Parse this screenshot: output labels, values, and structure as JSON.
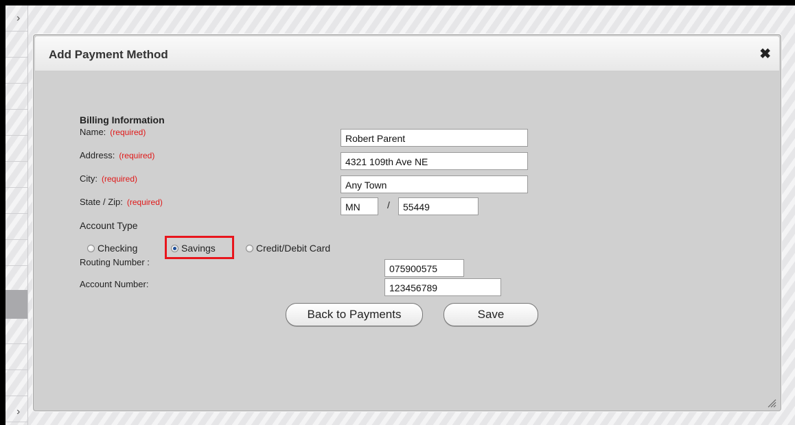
{
  "dialog": {
    "title": "Add Payment Method",
    "close_glyph": "✖"
  },
  "billing": {
    "section_title": "Billing Information",
    "required_text": "(required)",
    "name_label": "Name:",
    "name_value": "Robert Parent",
    "address_label": "Address:",
    "address_value": "4321 109th Ave NE",
    "city_label": "City:",
    "city_value": "Any Town",
    "state_zip_label": "State / Zip:",
    "state_value": "MN",
    "zip_separator": "/",
    "zip_value": "55449"
  },
  "account_type": {
    "label": "Account Type",
    "options": [
      "Checking",
      "Savings",
      "Credit/Debit Card"
    ],
    "selected": "Savings"
  },
  "bank": {
    "routing_label": "Routing Number :",
    "routing_value": "075900575",
    "account_label": "Account Number:",
    "account_value": "123456789"
  },
  "buttons": {
    "back_label": "Back to Payments",
    "save_label": "Save"
  },
  "background": {
    "chevron_glyph": "›"
  },
  "colors": {
    "required": "#e01818",
    "highlight": "#e8151c",
    "dialog_bg": "#d0d0d0"
  },
  "icons": [
    "close-icon",
    "resize-grip-icon",
    "chevron-right-icon",
    "radio-icon"
  ]
}
